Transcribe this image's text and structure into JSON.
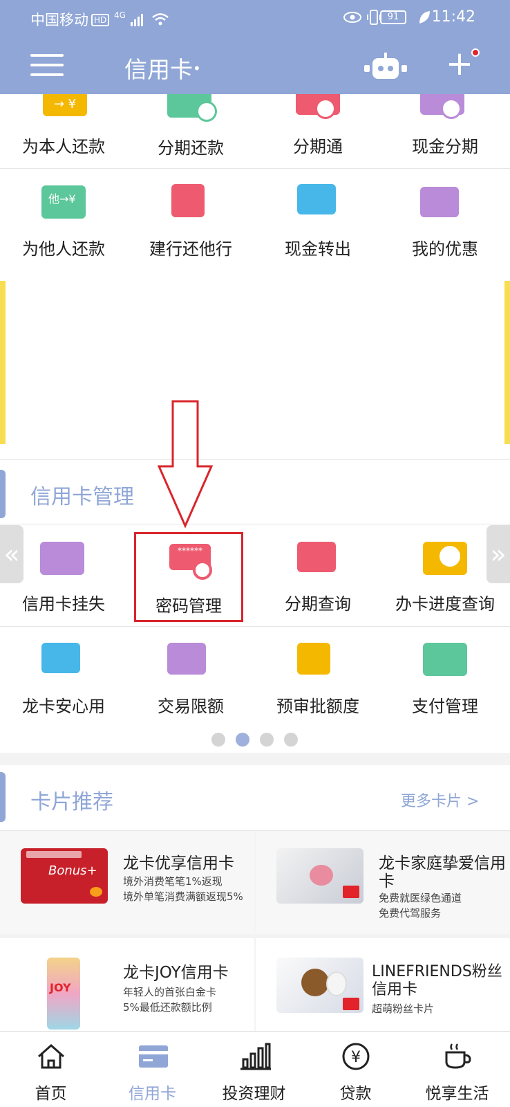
{
  "status_bar": {
    "carrier": "中国移动",
    "hd": "HD",
    "network": "4G",
    "battery": "91",
    "time": "11:42"
  },
  "header": {
    "title": "信用卡",
    "title_suffix": "•"
  },
  "quick_actions_row1": [
    {
      "label": "为本人还款",
      "icon": "transfer-yuan-icon"
    },
    {
      "label": "分期还款",
      "icon": "installment-repay-icon"
    },
    {
      "label": "分期通",
      "icon": "installment-pass-icon"
    },
    {
      "label": "现金分期",
      "icon": "cash-installment-icon"
    }
  ],
  "quick_actions_row2": [
    {
      "label": "为他人还款",
      "icon": "repay-others-icon"
    },
    {
      "label": "建行还他行",
      "icon": "cross-bank-repay-icon"
    },
    {
      "label": "现金转出",
      "icon": "cash-transfer-icon"
    },
    {
      "label": "我的优惠",
      "icon": "my-coupons-icon"
    }
  ],
  "card_management": {
    "section_title": "信用卡管理",
    "row1": [
      {
        "label": "信用卡挂失",
        "icon": "card-lost-icon"
      },
      {
        "label": "密码管理",
        "icon": "password-management-icon"
      },
      {
        "label": "分期查询",
        "icon": "installment-query-icon"
      },
      {
        "label": "办卡进度查询",
        "icon": "application-progress-icon"
      }
    ],
    "row2": [
      {
        "label": "龙卡安心用",
        "icon": "card-security-icon"
      },
      {
        "label": "交易限额",
        "icon": "transaction-limit-icon"
      },
      {
        "label": "预审批额度",
        "icon": "pre-approval-icon"
      },
      {
        "label": "支付管理",
        "icon": "payment-management-icon"
      }
    ],
    "pager": {
      "total": 4,
      "active_index": 1
    }
  },
  "card_recommend": {
    "section_title": "卡片推荐",
    "more_label": "更多卡片 >",
    "cards": [
      {
        "name": "龙卡优享信用卡",
        "desc1": "境外消费笔笔1%返现",
        "desc2": "境外单笔消费满额返现5%",
        "img_text": "Bonus+"
      },
      {
        "name": "龙卡家庭挚爱信用",
        "name2": "卡",
        "desc1": "免费就医绿色通道",
        "desc2": "免费代驾服务",
        "img_text": ""
      },
      {
        "name": "龙卡JOY信用卡",
        "desc1": "年轻人的首张白金卡",
        "desc2": "5%最低还款额比例",
        "img_text": "JOY"
      },
      {
        "name": "LINEFRIENDS粉丝",
        "name2": "信用卡",
        "desc1": "超萌粉丝卡片",
        "desc2": "",
        "img_text": ""
      }
    ]
  },
  "bottom_nav": [
    {
      "label": "首页",
      "icon": "home-icon",
      "active": false
    },
    {
      "label": "信用卡",
      "icon": "credit-card-icon",
      "active": true
    },
    {
      "label": "投资理财",
      "icon": "bar-chart-icon",
      "active": false
    },
    {
      "label": "贷款",
      "icon": "yuan-coin-icon",
      "active": false
    },
    {
      "label": "悦享生活",
      "icon": "coffee-cup-icon",
      "active": false
    }
  ],
  "colors": {
    "header_bg": "#8fa6d6",
    "highlight_border": "#d9252b",
    "banner_accent": "#f7dd52"
  }
}
